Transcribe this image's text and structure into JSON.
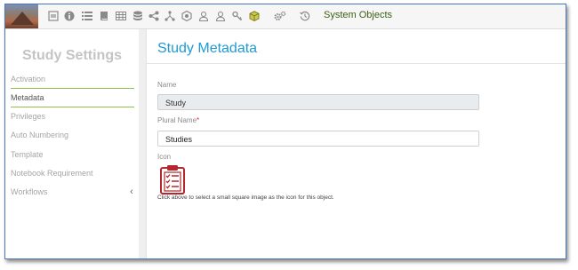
{
  "toolbar": {
    "icons": [
      "image-icon",
      "info-icon",
      "list-icon",
      "book-icon",
      "table-icon",
      "database-icon",
      "share-icon",
      "hierarchy-icon",
      "hexagon-icon",
      "user-icon",
      "key-icon",
      "cube-icon",
      "gears-icon",
      "history-icon"
    ],
    "label": "System Objects"
  },
  "sidebar": {
    "title": "Study Settings",
    "items": [
      {
        "label": "Activation"
      },
      {
        "label": "Metadata"
      },
      {
        "label": "Privileges"
      },
      {
        "label": "Auto Numbering"
      },
      {
        "label": "Template"
      },
      {
        "label": "Notebook Requirement"
      },
      {
        "label": "Workflows"
      }
    ]
  },
  "main": {
    "title": "Study Metadata",
    "name": {
      "label": "Name",
      "value": "Study"
    },
    "plural": {
      "label": "Plural Name",
      "required": "*",
      "value": "Studies"
    },
    "icon": {
      "label": "Icon",
      "hint": "Click above to select a small square image as the icon for this object."
    }
  },
  "colors": {
    "accent": "#1e9ad6",
    "active_line": "#8dc34a",
    "toolbar_label": "#3b5d14",
    "required": "#d6333a",
    "icon_red": "#b3282d"
  }
}
